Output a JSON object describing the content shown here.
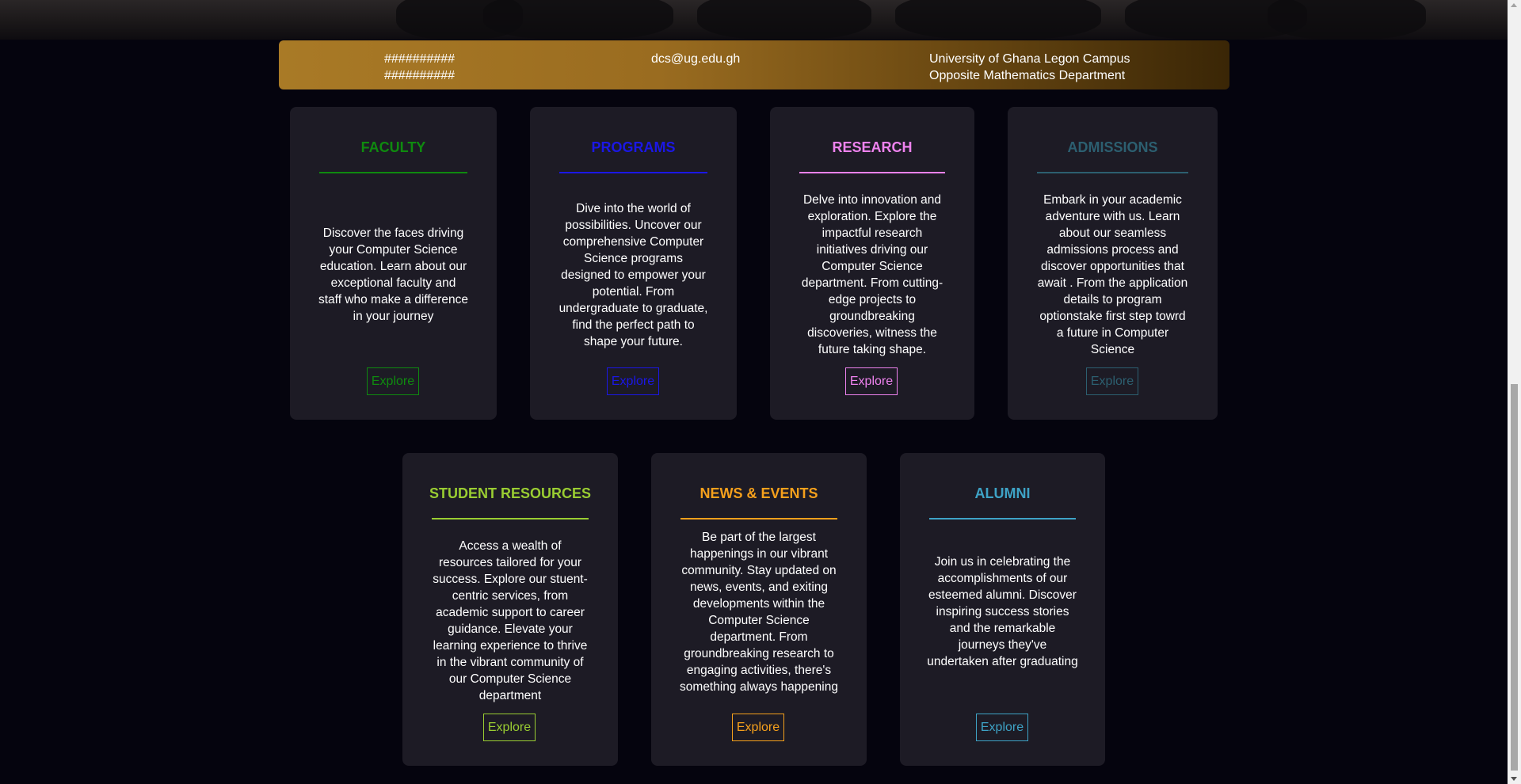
{
  "contact": {
    "phone_1": "##########",
    "phone_2": "##########",
    "email": "dcs@ug.edu.gh",
    "address_line_1": "University of Ghana Legon Campus",
    "address_line_2": "Opposite Mathematics Department"
  },
  "cards": {
    "faculty": {
      "title": "FACULTY",
      "color": "#0f8a0f",
      "description": "Discover the faces driving your Computer Science education. Learn about our exceptional faculty and staff who make a difference in your journey",
      "button_label": "Explore"
    },
    "programs": {
      "title": "PROGRAMS",
      "color": "#1b17e6",
      "description": "Dive into the world of possibilities. Uncover our comprehensive Computer Science programs designed to empower your potential. From undergraduate to graduate, find the perfect path to shape your future.",
      "button_label": "Explore"
    },
    "research": {
      "title": "RESEARCH",
      "color": "#ee82ee",
      "description": "Delve into innovation and exploration. Explore the impactful research initiatives driving our Computer Science department. From cutting-edge projects to groundbreaking discoveries, witness the future taking shape.",
      "button_label": "Explore"
    },
    "admissions": {
      "title": "ADMISSIONS",
      "color": "#2c5f70",
      "description": "Embark in your academic adventure with us. Learn about our seamless admissions process and discover opportunities that await . From the application details to program optionstake first step towrd a future in Computer Science",
      "button_label": "Explore"
    },
    "student_resources": {
      "title": "STUDENT RESOURCES",
      "color": "#9acd32",
      "description": "Access a wealth of resources tailored for your success. Explore our stuent-centric services, from academic support to career guidance. Elevate your learning experience to thrive in the vibrant community of our Computer Science department",
      "button_label": "Explore"
    },
    "news_events": {
      "title": "NEWS & EVENTS",
      "color": "#f5a01c",
      "description": "Be part of the largest happenings in our vibrant community. Stay updated on news, events, and exiting developments within the Computer Science department. From groundbreaking research to engaging activities, there's something always happening",
      "button_label": "Explore"
    },
    "alumni": {
      "title": "ALUMNI",
      "color": "#3ea3c6",
      "description": "Join us in celebrating the accomplishments of our esteemed alumni. Discover inspiring success stories and the remarkable journeys they've undertaken after graduating",
      "button_label": "Explore"
    }
  }
}
